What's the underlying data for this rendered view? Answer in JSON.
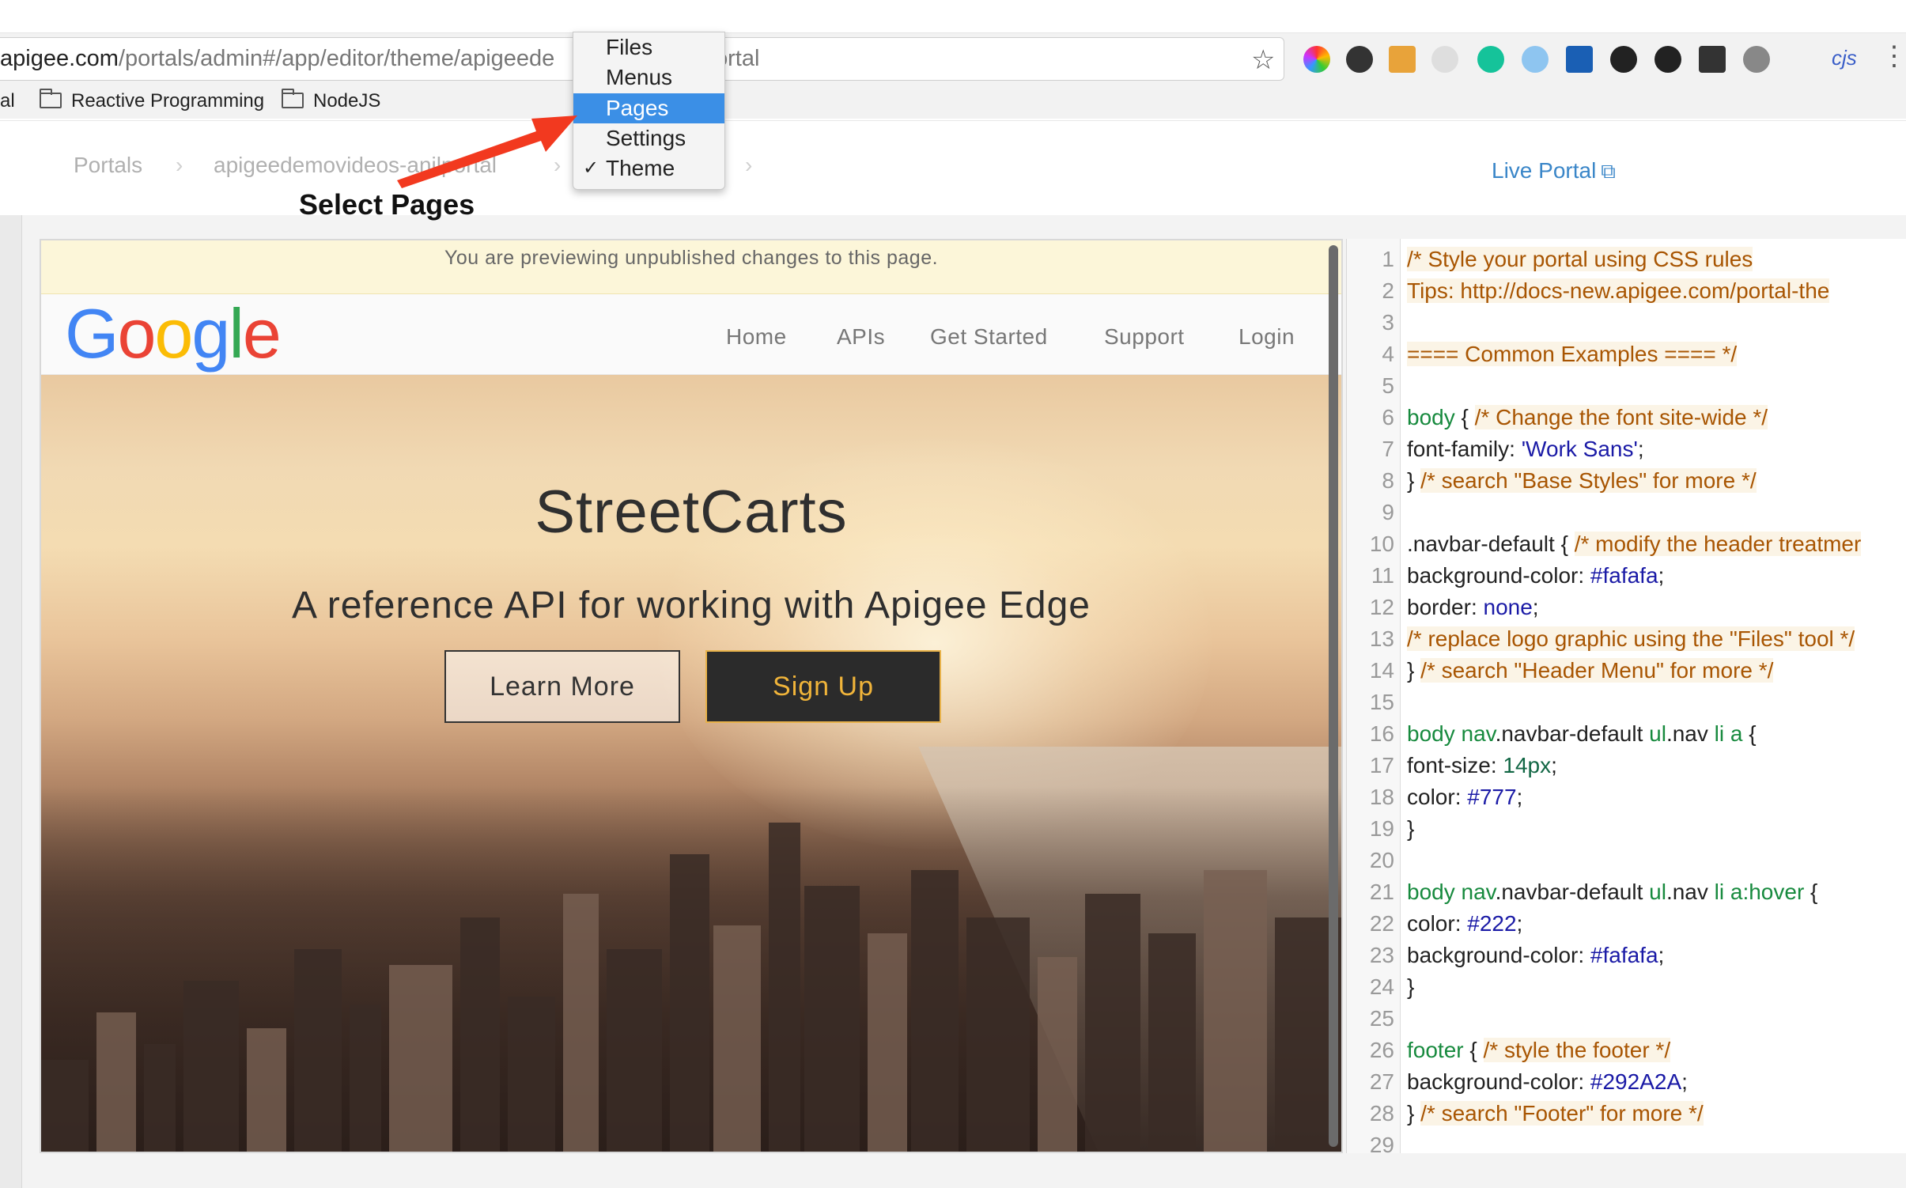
{
  "browser": {
    "url_host": "apigee.com",
    "url_path": "/portals/admin#/app/editor/theme/apigeede",
    "url_tail": "ortal",
    "extension_icons": [
      "color-wheel-icon",
      "colorpick-eyedropper-icon",
      "lighthouse-icon",
      "json-viewer-icon",
      "grammarly-icon",
      "snowflake-icon",
      "analytics-icon",
      "gif-icon",
      "storybook-icon",
      "film-icon",
      "cursor-icon"
    ],
    "extension_label": "cjs",
    "bookmarks": [
      {
        "label": "al"
      },
      {
        "label": "Reactive Programming"
      },
      {
        "label": "NodeJS"
      }
    ]
  },
  "header": {
    "breadcrumb": [
      "Portals",
      "apigeedemovideos-anilportal"
    ],
    "live_portal_label": "Live Portal"
  },
  "dropdown": {
    "items": [
      {
        "label": "Files",
        "selected": false,
        "checked": false
      },
      {
        "label": "Menus",
        "selected": false,
        "checked": false
      },
      {
        "label": "Pages",
        "selected": true,
        "checked": false
      },
      {
        "label": "Settings",
        "selected": false,
        "checked": false
      },
      {
        "label": "Theme",
        "selected": false,
        "checked": true
      }
    ],
    "highlight_color": "#3b8fe6"
  },
  "annotation": {
    "text": "Select Pages",
    "arrow_color": "#f2391f"
  },
  "preview": {
    "notice": "You are previewing unpublished changes to this page.",
    "logo": [
      "G",
      "o",
      "o",
      "g",
      "l",
      "e"
    ],
    "nav": [
      "Home",
      "APIs",
      "Get Started",
      "Support",
      "Login"
    ],
    "hero_title": "StreetCarts",
    "hero_subtitle": "A reference API for working with Apigee Edge",
    "learn_more_label": "Learn More",
    "sign_up_label": "Sign Up",
    "accent_color": "#f0b43a"
  },
  "editor": {
    "lines": [
      {
        "n": "1",
        "segs": [
          {
            "t": "/* Style your portal using CSS rules",
            "c": "cm"
          }
        ]
      },
      {
        "n": "2",
        "segs": [
          {
            "t": "  Tips: http://docs-new.apigee.com/portal-the",
            "c": "cm"
          }
        ]
      },
      {
        "n": "3",
        "segs": []
      },
      {
        "n": "4",
        "segs": [
          {
            "t": "  ==== Common Examples ==== */",
            "c": "cm"
          }
        ]
      },
      {
        "n": "5",
        "segs": []
      },
      {
        "n": "6",
        "segs": [
          {
            "t": "body",
            "c": "kw"
          },
          {
            "t": " { ",
            "c": "pl"
          },
          {
            "t": "/* Change the font site-wide */",
            "c": "cm"
          }
        ]
      },
      {
        "n": "7",
        "segs": [
          {
            "t": "  font-family: ",
            "c": "pl"
          },
          {
            "t": "'Work Sans'",
            "c": "st"
          },
          {
            "t": ";",
            "c": "pl"
          }
        ]
      },
      {
        "n": "8",
        "segs": [
          {
            "t": "} ",
            "c": "pl"
          },
          {
            "t": "/* search \"Base Styles\" for more */",
            "c": "cm"
          }
        ]
      },
      {
        "n": "9",
        "segs": []
      },
      {
        "n": "10",
        "segs": [
          {
            "t": ".navbar-default { ",
            "c": "pl"
          },
          {
            "t": "/* modify the header treatmer",
            "c": "cm"
          }
        ]
      },
      {
        "n": "11",
        "segs": [
          {
            "t": "  background-color: ",
            "c": "pl"
          },
          {
            "t": "#fafafa",
            "c": "va"
          },
          {
            "t": ";",
            "c": "pl"
          }
        ]
      },
      {
        "n": "12",
        "segs": [
          {
            "t": "  border: ",
            "c": "pl"
          },
          {
            "t": "none",
            "c": "va"
          },
          {
            "t": ";",
            "c": "pl"
          }
        ]
      },
      {
        "n": "13",
        "segs": [
          {
            "t": "/* replace logo graphic using the \"Files\" tool */",
            "c": "cm"
          }
        ]
      },
      {
        "n": "14",
        "segs": [
          {
            "t": "} ",
            "c": "pl"
          },
          {
            "t": "/* search \"Header Menu\" for more */",
            "c": "cm"
          }
        ]
      },
      {
        "n": "15",
        "segs": []
      },
      {
        "n": "16",
        "segs": [
          {
            "t": "body",
            "c": "kw"
          },
          {
            "t": " ",
            "c": "pl"
          },
          {
            "t": "nav",
            "c": "kw"
          },
          {
            "t": ".navbar-default ",
            "c": "pl"
          },
          {
            "t": "ul",
            "c": "kw"
          },
          {
            "t": ".nav ",
            "c": "pl"
          },
          {
            "t": "li a",
            "c": "kw"
          },
          {
            "t": " {",
            "c": "pl"
          }
        ]
      },
      {
        "n": "17",
        "segs": [
          {
            "t": "    font-size: ",
            "c": "pl"
          },
          {
            "t": "14px",
            "c": "nu"
          },
          {
            "t": ";",
            "c": "pl"
          }
        ]
      },
      {
        "n": "18",
        "segs": [
          {
            "t": "    color: ",
            "c": "pl"
          },
          {
            "t": "#777",
            "c": "va"
          },
          {
            "t": ";",
            "c": "pl"
          }
        ]
      },
      {
        "n": "19",
        "segs": [
          {
            "t": "}",
            "c": "pl"
          }
        ]
      },
      {
        "n": "20",
        "segs": []
      },
      {
        "n": "21",
        "segs": [
          {
            "t": "body",
            "c": "kw"
          },
          {
            "t": " ",
            "c": "pl"
          },
          {
            "t": "nav",
            "c": "kw"
          },
          {
            "t": ".navbar-default ",
            "c": "pl"
          },
          {
            "t": "ul",
            "c": "kw"
          },
          {
            "t": ".nav ",
            "c": "pl"
          },
          {
            "t": "li a",
            "c": "kw"
          },
          {
            "t": ":hover",
            "c": "kw"
          },
          {
            "t": " {",
            "c": "pl"
          }
        ]
      },
      {
        "n": "22",
        "segs": [
          {
            "t": "    color: ",
            "c": "pl"
          },
          {
            "t": "#222",
            "c": "va"
          },
          {
            "t": ";",
            "c": "pl"
          }
        ]
      },
      {
        "n": "23",
        "segs": [
          {
            "t": "    background-color: ",
            "c": "pl"
          },
          {
            "t": "#fafafa",
            "c": "va"
          },
          {
            "t": ";",
            "c": "pl"
          }
        ]
      },
      {
        "n": "24",
        "segs": [
          {
            "t": "}",
            "c": "pl"
          }
        ]
      },
      {
        "n": "25",
        "segs": []
      },
      {
        "n": "26",
        "segs": [
          {
            "t": "footer",
            "c": "kw"
          },
          {
            "t": " { ",
            "c": "pl"
          },
          {
            "t": "/* style the footer */",
            "c": "cm"
          }
        ]
      },
      {
        "n": "27",
        "segs": [
          {
            "t": "  background-color: ",
            "c": "pl"
          },
          {
            "t": "#292A2A",
            "c": "va"
          },
          {
            "t": ";",
            "c": "pl"
          }
        ]
      },
      {
        "n": "28",
        "segs": [
          {
            "t": "} ",
            "c": "pl"
          },
          {
            "t": "/* search \"Footer\" for more */",
            "c": "cm"
          }
        ]
      },
      {
        "n": "29",
        "segs": []
      }
    ]
  }
}
